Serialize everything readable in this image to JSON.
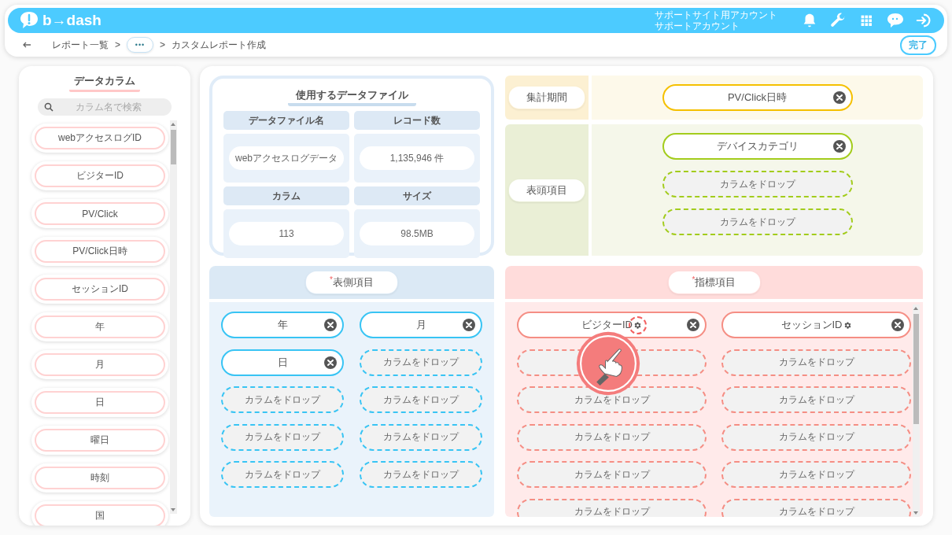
{
  "header": {
    "logo": "b→dash",
    "account": [
      "サポートサイト用アカウント",
      "サポートアカウント"
    ]
  },
  "breadcrumb": [
    {
      "kind": "link",
      "label": "レポート一覧"
    },
    {
      "kind": "sep",
      "label": ">"
    },
    {
      "kind": "more",
      "label": "•••"
    },
    {
      "kind": "sep",
      "label": ">"
    },
    {
      "kind": "current",
      "label": "カスタムレポート作成"
    }
  ],
  "done_button": "完了",
  "sidebar": {
    "title": "データカラム",
    "search": {
      "placeholder": "カラム名で検索"
    },
    "columns": [
      "webアクセスログID",
      "ビジターID",
      "PV/Click",
      "PV/Click日時",
      "セッションID",
      "年",
      "月",
      "日",
      "曜日",
      "時刻",
      "国"
    ]
  },
  "data_file": {
    "title": "使用するデータファイル",
    "fields": [
      {
        "label": "データファイル名",
        "value": "webアクセスログデータ"
      },
      {
        "label": "レコード数",
        "value": "1,135,946 件"
      },
      {
        "label": "カラム",
        "value": "113"
      },
      {
        "label": "サイズ",
        "value": "98.5MB"
      }
    ]
  },
  "sections": [
    {
      "kind": "period",
      "label": "集計期間",
      "slots": [
        {
          "kind": "filled",
          "label": "PV/Click日時"
        }
      ]
    },
    {
      "kind": "column",
      "label": "表頭項目",
      "slots": [
        {
          "kind": "filled",
          "label": "デバイスカテゴリ"
        },
        {
          "kind": "drop",
          "label": "カラムをドロップ"
        },
        {
          "kind": "drop",
          "label": "カラムをドロップ"
        }
      ]
    },
    {
      "kind": "row",
      "label": "表側項目",
      "required_mark": "*",
      "slots": [
        {
          "kind": "filled",
          "label": "年"
        },
        {
          "kind": "filled",
          "label": "月"
        },
        {
          "kind": "filled",
          "label": "日"
        },
        {
          "kind": "drop",
          "label": "カラムをドロップ"
        },
        {
          "kind": "drop",
          "label": "カラムをドロップ"
        },
        {
          "kind": "drop",
          "label": "カラムをドロップ"
        },
        {
          "kind": "drop",
          "label": "カラムをドロップ"
        },
        {
          "kind": "drop",
          "label": "カラムをドロップ"
        },
        {
          "kind": "drop",
          "label": "カラムをドロップ"
        },
        {
          "kind": "drop",
          "label": "カラムをドロップ"
        }
      ]
    },
    {
      "kind": "metric",
      "label": "指標項目",
      "required_mark": "*",
      "slots": [
        {
          "kind": "filled",
          "label": "ビジターID",
          "settings": true,
          "focused": true
        },
        {
          "kind": "filled",
          "label": "セッションID",
          "settings": true,
          "focused": false
        },
        {
          "kind": "drop"
        },
        {
          "kind": "drop",
          "label": "カラムをドロップ"
        },
        {
          "kind": "drop",
          "label": "カラムをドロップ"
        },
        {
          "kind": "drop",
          "label": "カラムをドロップ"
        },
        {
          "kind": "drop",
          "label": "カラムをドロップ"
        },
        {
          "kind": "drop",
          "label": "カラムをドロップ"
        },
        {
          "kind": "drop",
          "label": "カラムをドロップ"
        },
        {
          "kind": "drop",
          "label": "カラムをドロップ"
        },
        {
          "kind": "drop",
          "label": "カラムをドロップ"
        },
        {
          "kind": "drop",
          "label": "カラムをドロップ"
        }
      ]
    }
  ]
}
